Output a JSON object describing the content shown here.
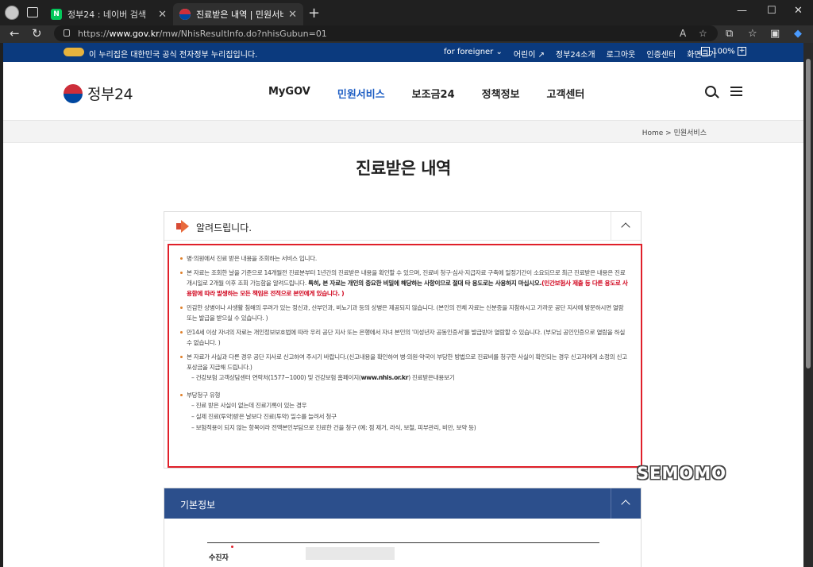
{
  "browser": {
    "tabs": [
      {
        "title": "정부24 : 네이버 검색",
        "favicon": "naver-icon",
        "active": false
      },
      {
        "title": "진료받은 내역 | 민원서비스 | 정부",
        "favicon": "gov24-icon",
        "active": true
      }
    ],
    "new_tab": "+",
    "url_prefix": "https://",
    "url_host": "www.gov.kr",
    "url_path": "/mw/NhisResultInfo.do?nhisGubun=01",
    "window_controls": [
      "—",
      "☐",
      "✕"
    ]
  },
  "gov_banner": {
    "message": "이 누리집은 대한민국 공식 전자정부 누리집입니다.",
    "links": [
      "for foreigner",
      "어린이",
      "정부24소개",
      "로그아웃",
      "인증센터",
      "화면크기"
    ],
    "zoom_minus": "−",
    "zoom_level": "100%",
    "zoom_plus": "+"
  },
  "header": {
    "brand": "정부24",
    "nav": [
      {
        "label": "MyGOV",
        "active": false
      },
      {
        "label": "민원서비스",
        "active": true
      },
      {
        "label": "보조금24",
        "active": false
      },
      {
        "label": "정책정보",
        "active": false
      },
      {
        "label": "고객센터",
        "active": false
      }
    ]
  },
  "breadcrumb": {
    "home": "Home",
    "separator": ">",
    "current": "민원서비스"
  },
  "page_title": "진료받은 내역",
  "notice": {
    "title": "알려드립니다.",
    "items": {
      "i1": "병·의원에서 진료 받은 내용을 조회하는 서비스 입니다.",
      "i2_a": "본 자료는 조회한 날을 기준으로 14개월전 진료분부터 1년간의 진료받은 내용을 확인할 수 있으며, 진료비 청구·심사·지급자료 구축에 일정기간이 소요되므로 최근 진료받은 내용은 진료개시일로 2개월 이후 조회 가능함을 알려드립니다. ",
      "i2_b": "특히, 본 자료는 개인의 중요한 비밀에 해당하는 사항이므로 절대 타 용도로는 사용하지 마십시오.",
      "i2_c": "(민간보험사 제출 등 다른 용도로 사용함에 따라 발생하는 모든 책임은 전적으로 본인에게 있습니다. )",
      "i3": "민감한 상병이나 사생활 침해의 우려가 있는 정신과, 산부인과, 비뇨기과 등의 상병은 제공되지 않습니다. (본인의 전체 자료는 신분증을 지참하시고 가까운 공단 지사에 방문하시면 열람 또는 발급을 받으실 수 있습니다. )",
      "i4": "만14세 이상 자녀의 자료는 개인정보보호법에 따라 우리 공단 지사 또는 은행에서 자녀 본인의 '미성년자 공동인증서'를 발급받아 열람할 수 있습니다. (부모님 공인인증으로 열람을 하실 수 없습니다. )",
      "i5": "본 자료가 사실과 다른 경우 공단 지사로 신고하여 주시기 바랍니다.(신고내용을 확인하여 병·의원·약국이 부당한 방법으로 진료비를 청구한 사실이 확인되는 경우 신고자에게 소정의 신고포상금을 지급해 드립니다.)",
      "i5_sub_a": "– 건강보험 고객상담센터 연락처(1577−1000) 및 건강보험 홈페이지(",
      "i5_sub_b": "www.nhis.or.kr",
      "i5_sub_c": ") 진료받은내용보기",
      "i6": "부당청구 유형",
      "i6_sub1": "– 진료 받은 사실이 없는데 진료기록이 있는 경우",
      "i6_sub2": "– 실제 진료(투약)받은 날보다 진료(투약) 일수를 늘려서 청구",
      "i6_sub3": "– 보험적용이 되지 않는 항목이라 전액본인부담으로 진료한 건을 청구 (예: 점 제거, 라식, 보철, 피부관리, 비만, 보약 등)"
    }
  },
  "watermark": "SEMOMO",
  "basic_info": {
    "title": "기본정보",
    "field_label": "수진자"
  },
  "colors": {
    "gov_blue": "#0b3a7e",
    "accent_blue": "#1f5fc4",
    "section_blue": "#2c4f8c",
    "highlight_red": "#e0202a"
  }
}
